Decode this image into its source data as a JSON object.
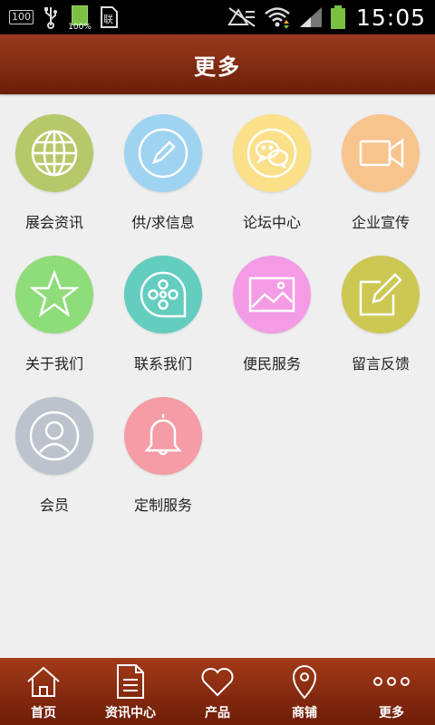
{
  "status_bar": {
    "left_box": "100",
    "battery_pct": "100%",
    "time": "15:05",
    "icons": [
      "notification-100-icon",
      "usb-icon",
      "battery-full-icon",
      "sim-icon",
      "no-signal-icon",
      "wifi-icon",
      "cell-signal-icon",
      "battery-icon"
    ]
  },
  "header": {
    "title": "更多"
  },
  "grid": {
    "items": [
      {
        "label": "展会资讯",
        "icon": "globe-icon",
        "color": "#b5c96a"
      },
      {
        "label": "供/求信息",
        "icon": "pencil-icon",
        "color": "#9fd3f2"
      },
      {
        "label": "论坛中心",
        "icon": "chat-icon",
        "color": "#fbe08a"
      },
      {
        "label": "企业宣传",
        "icon": "video-camera-icon",
        "color": "#f8c48e"
      },
      {
        "label": "关于我们",
        "icon": "star-icon",
        "color": "#8fdc7a"
      },
      {
        "label": "联系我们",
        "icon": "film-reel-icon",
        "color": "#63cdc0"
      },
      {
        "label": "便民服务",
        "icon": "image-icon",
        "color": "#f39be4"
      },
      {
        "label": "留言反馈",
        "icon": "edit-icon",
        "color": "#ccc853"
      },
      {
        "label": "会员",
        "icon": "user-icon",
        "color": "#bcc3cd"
      },
      {
        "label": "定制服务",
        "icon": "bell-icon",
        "color": "#f59ca6"
      }
    ]
  },
  "bottom_nav": {
    "items": [
      {
        "label": "首页",
        "icon": "home-icon"
      },
      {
        "label": "资讯中心",
        "icon": "document-icon"
      },
      {
        "label": "产品",
        "icon": "heart-icon"
      },
      {
        "label": "商铺",
        "icon": "location-pin-icon"
      },
      {
        "label": "更多",
        "icon": "more-dots-icon"
      }
    ]
  }
}
